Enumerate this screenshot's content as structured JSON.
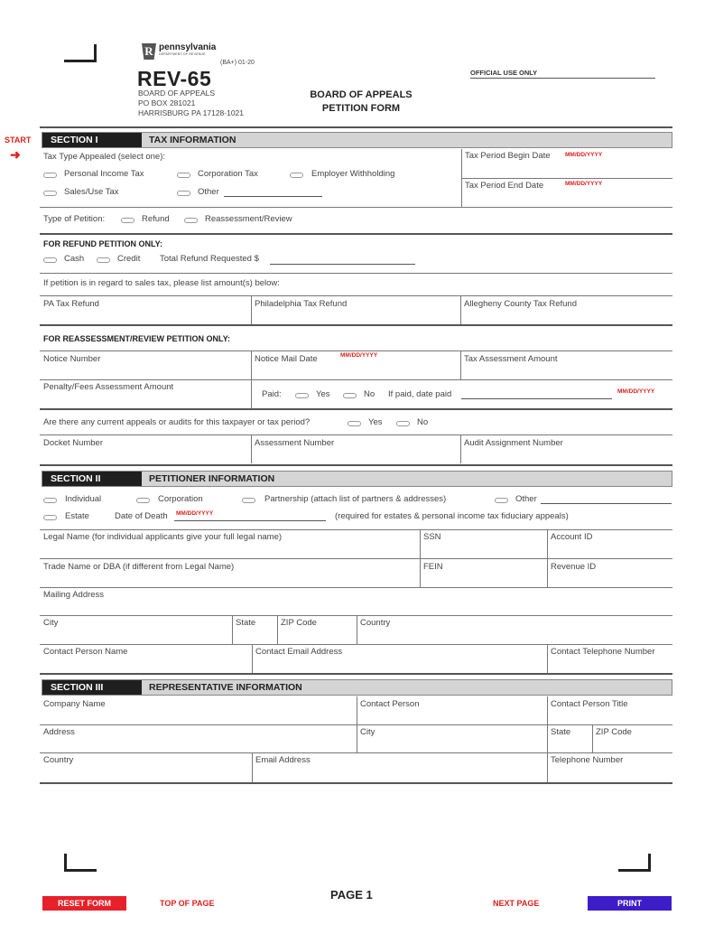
{
  "header": {
    "agency_name": "pennsylvania",
    "agency_dept": "DEPARTMENT OF REVENUE",
    "keystone_letter": "R",
    "form_version": "(BA+) 01-20",
    "form_number": "REV-65",
    "address_lines": [
      "BOARD OF APPEALS",
      "PO BOX 281021",
      "HARRISBURG PA 17128-1021"
    ],
    "title_line1": "BOARD OF APPEALS",
    "title_line2": "PETITION FORM",
    "official_use": "OFFICIAL USE ONLY"
  },
  "start": {
    "label": "START",
    "arrow_icon": "arrow-right-icon",
    "arrow": "➜"
  },
  "date_format": "MM/DD/YYYY",
  "section1": {
    "label": "SECTION I",
    "title": "TAX INFORMATION",
    "tax_type_prompt": "Tax Type Appealed (select one):",
    "tax_types": [
      "Personal Income Tax",
      "Corporation Tax",
      "Employer Withholding",
      "Sales/Use Tax",
      "Other"
    ],
    "begin_date_label": "Tax Period Begin Date",
    "end_date_label": "Tax Period End Date",
    "petition_type_label": "Type of Petition:",
    "petition_types": [
      "Refund",
      "Reassessment/Review"
    ],
    "refund_heading": "FOR REFUND PETITION ONLY:",
    "refund_options": [
      "Cash",
      "Credit"
    ],
    "total_refund_label": "Total Refund Requested $",
    "sales_tax_note": "If petition is in regard to sales tax, please list amount(s) below:",
    "refund_fields": [
      "PA Tax Refund",
      "Philadelphia Tax Refund",
      "Allegheny County Tax Refund"
    ],
    "reassess_heading": "FOR REASSESSMENT/REVIEW PETITION ONLY:",
    "notice_number": "Notice Number",
    "notice_mail_date": "Notice Mail Date",
    "tax_assessment_amount": "Tax Assessment Amount",
    "penalty_amount": "Penalty/Fees Assessment Amount",
    "paid_label": "Paid:",
    "yes": "Yes",
    "no": "No",
    "date_paid_label": "If paid, date paid",
    "appeals_question": "Are there any current appeals or audits for this taxpayer or tax period?",
    "docket_number": "Docket Number",
    "assessment_number": "Assessment Number",
    "audit_assignment_number": "Audit Assignment Number"
  },
  "section2": {
    "label": "SECTION II",
    "title": "PETITIONER INFORMATION",
    "entity_types": [
      "Individual",
      "Corporation",
      "Partnership (attach list of partners & addresses)",
      "Other",
      "Estate"
    ],
    "date_of_death": "Date of Death",
    "estate_note": "(required for estates & personal income tax fiduciary appeals)",
    "legal_name": "Legal Name (for individual applicants give your full legal name)",
    "ssn": "SSN",
    "account_id": "Account ID",
    "trade_name": "Trade Name or DBA (if different from Legal Name)",
    "fein": "FEIN",
    "revenue_id": "Revenue ID",
    "mailing_address": "Mailing Address",
    "city": "City",
    "state": "State",
    "zip": "ZIP Code",
    "country": "Country",
    "contact_name": "Contact Person Name",
    "contact_email": "Contact Email Address",
    "contact_phone": "Contact Telephone Number"
  },
  "section3": {
    "label": "SECTION III",
    "title": "REPRESENTATIVE INFORMATION",
    "company_name": "Company Name",
    "contact_person": "Contact Person",
    "contact_title": "Contact Person Title",
    "address": "Address",
    "city": "City",
    "state": "State",
    "zip": "ZIP Code",
    "country": "Country",
    "email": "Email Address",
    "phone": "Telephone Number"
  },
  "footer": {
    "reset": "RESET FORM",
    "top": "TOP OF PAGE",
    "page": "PAGE 1",
    "next": "NEXT PAGE",
    "print": "PRINT"
  }
}
